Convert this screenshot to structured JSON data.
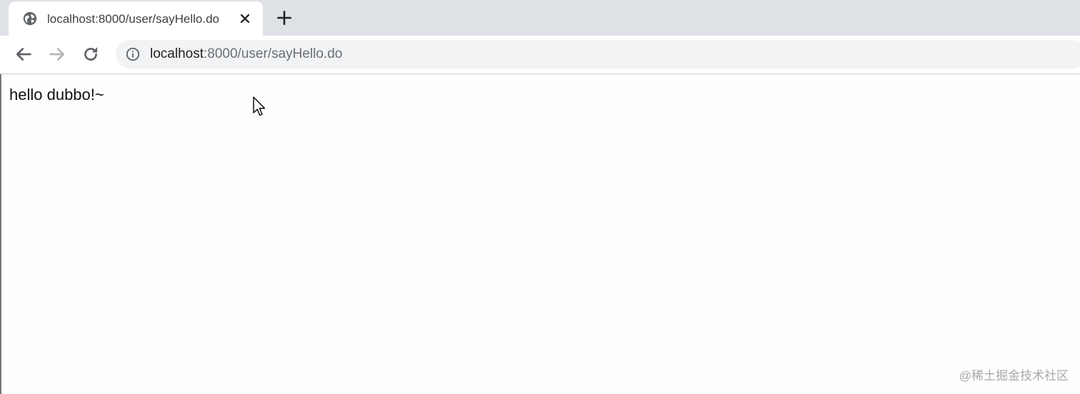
{
  "tab": {
    "title": "localhost:8000/user/sayHello.do",
    "favicon": "globe-icon"
  },
  "toolbar": {
    "back_icon": "back-arrow-icon",
    "forward_icon": "forward-arrow-icon",
    "reload_icon": "reload-icon",
    "new_tab_icon": "plus-icon",
    "close_icon": "close-icon"
  },
  "address_bar": {
    "info_icon": "info-icon",
    "host": "localhost",
    "rest": ":8000/user/sayHello.do"
  },
  "page": {
    "text": "hello dubbo!~"
  },
  "watermark": {
    "text": "@稀土掘金技术社区"
  },
  "colors": {
    "tabstrip": "#dee1e6",
    "omnibox": "#f1f3f4",
    "icon": "#5f6368"
  }
}
